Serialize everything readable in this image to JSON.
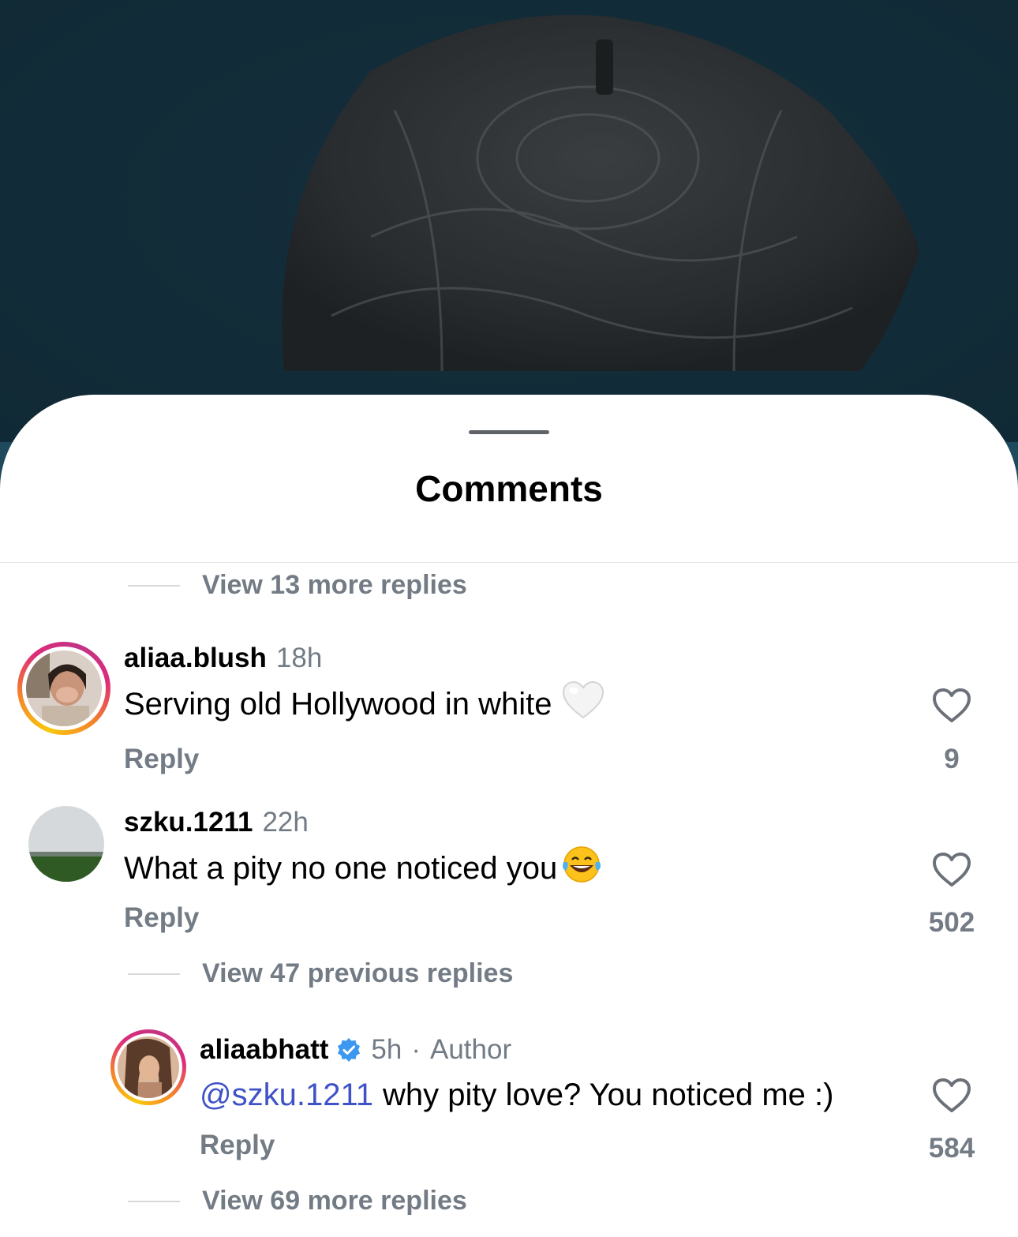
{
  "sheet": {
    "title": "Comments"
  },
  "view_top": "View 13 more replies",
  "comments": [
    {
      "username": "aliaa.blush",
      "time": "18h",
      "text": "Serving old Hollywood in white",
      "emoji": "white-heart",
      "reply_label": "Reply",
      "likes": "9"
    },
    {
      "username": "szku.1211",
      "time": "22h",
      "text": "What a pity no one noticed you",
      "emoji": "tears-of-joy",
      "reply_label": "Reply",
      "likes": "502"
    }
  ],
  "view_previous": "View 47 previous replies",
  "author_reply": {
    "username": "aliaabhatt",
    "time": "5h",
    "separator": "·",
    "badge": "Author",
    "mention": "@szku.1211",
    "text": "why pity love? You noticed me :)",
    "reply_label": "Reply",
    "likes": "584"
  },
  "view_bottom": "View 69 more replies",
  "colors": {
    "mention": "#3f52c7",
    "meta": "#737b85",
    "verified": "#3b97f0"
  }
}
